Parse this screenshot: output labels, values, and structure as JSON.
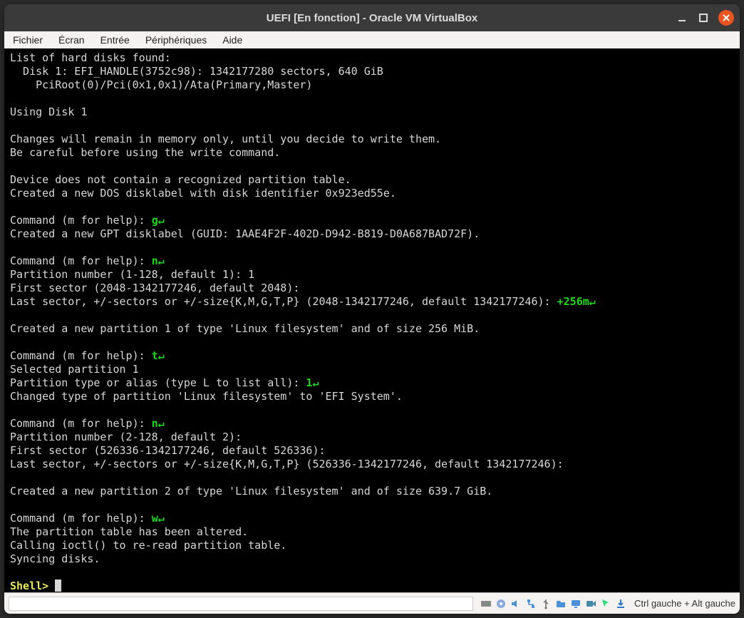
{
  "window": {
    "title": "UEFI [En fonction] - Oracle VM VirtualBox"
  },
  "menubar": {
    "file": "Fichier",
    "display": "Écran",
    "input": "Entrée",
    "devices": "Périphériques",
    "help": "Aide"
  },
  "statusbar": {
    "hostkey": "Ctrl gauche + Alt gauche"
  },
  "term": {
    "l01": "List of hard disks found:",
    "l02": "  Disk 1: EFI_HANDLE(3752c98): 1342177280 sectors, 640 GiB",
    "l03": "    PciRoot(0)/Pci(0x1,0x1)/Ata(Primary,Master)",
    "l04": "",
    "l05": "Using Disk 1",
    "l06": "",
    "l07": "Changes will remain in memory only, until you decide to write them.",
    "l08": "Be careful before using the write command.",
    "l09": "",
    "l10": "Device does not contain a recognized partition table.",
    "l11": "Created a new DOS disklabel with disk identifier 0x923ed55e.",
    "l12": "",
    "cmd1": {
      "p": "Command (m for help): ",
      "in": "g"
    },
    "l14": "Created a new GPT disklabel (GUID: 1AAE4F2F-402D-D942-B819-D0A687BAD72F).",
    "l15": "",
    "cmd2": {
      "p": "Command (m for help): ",
      "in": "n"
    },
    "l17": "Partition number (1-128, default 1): 1",
    "l18": "First sector (2048-1342177246, default 2048):",
    "ls1": {
      "p": "Last sector, +/-sectors or +/-size{K,M,G,T,P} (2048-1342177246, default 1342177246): ",
      "in": "+256m"
    },
    "l20": "",
    "l21": "Created a new partition 1 of type 'Linux filesystem' and of size 256 MiB.",
    "l22": "",
    "cmd3": {
      "p": "Command (m for help): ",
      "in": "t"
    },
    "l24": "Selected partition 1",
    "pt1": {
      "p": "Partition type or alias (type L to list all): ",
      "in": "1"
    },
    "l26": "Changed type of partition 'Linux filesystem' to 'EFI System'.",
    "l27": "",
    "cmd4": {
      "p": "Command (m for help): ",
      "in": "n"
    },
    "l29": "Partition number (2-128, default 2):",
    "l30": "First sector (526336-1342177246, default 526336):",
    "l31": "Last sector, +/-sectors or +/-size{K,M,G,T,P} (526336-1342177246, default 1342177246):",
    "l32": "",
    "l33": "Created a new partition 2 of type 'Linux filesystem' and of size 639.7 GiB.",
    "l34": "",
    "cmd5": {
      "p": "Command (m for help): ",
      "in": "w"
    },
    "l36": "The partition table has been altered.",
    "l37": "Calling ioctl() to re-read partition table.",
    "l38": "Syncing disks.",
    "l39": "",
    "shell": "Shell> "
  },
  "glyph": {
    "enter": "↵"
  }
}
